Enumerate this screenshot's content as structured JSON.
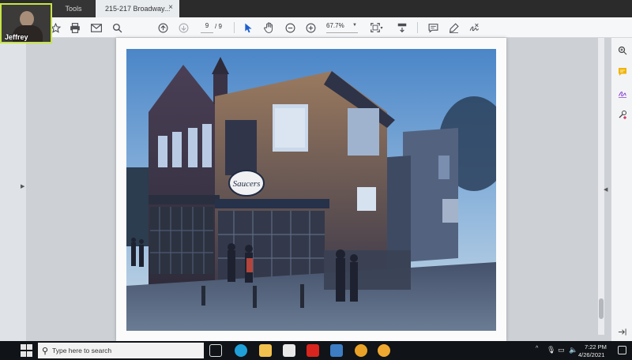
{
  "tabs": {
    "tools_label": "Tools",
    "document_label": "215-217 Broadway...",
    "close_glyph": "×"
  },
  "toolbar": {
    "page_current": "9",
    "page_total": "/ 9",
    "zoom": "67.7%"
  },
  "video": {
    "participant_name": "Jeffrey"
  },
  "taskbar": {
    "search_placeholder": "Type here to search",
    "time": "7:22 PM",
    "date": "4/26/2021"
  },
  "document": {
    "sign_text": "Saucers"
  },
  "colors": {
    "accent": "#1a5fd0",
    "video_border": "#c6e447"
  }
}
